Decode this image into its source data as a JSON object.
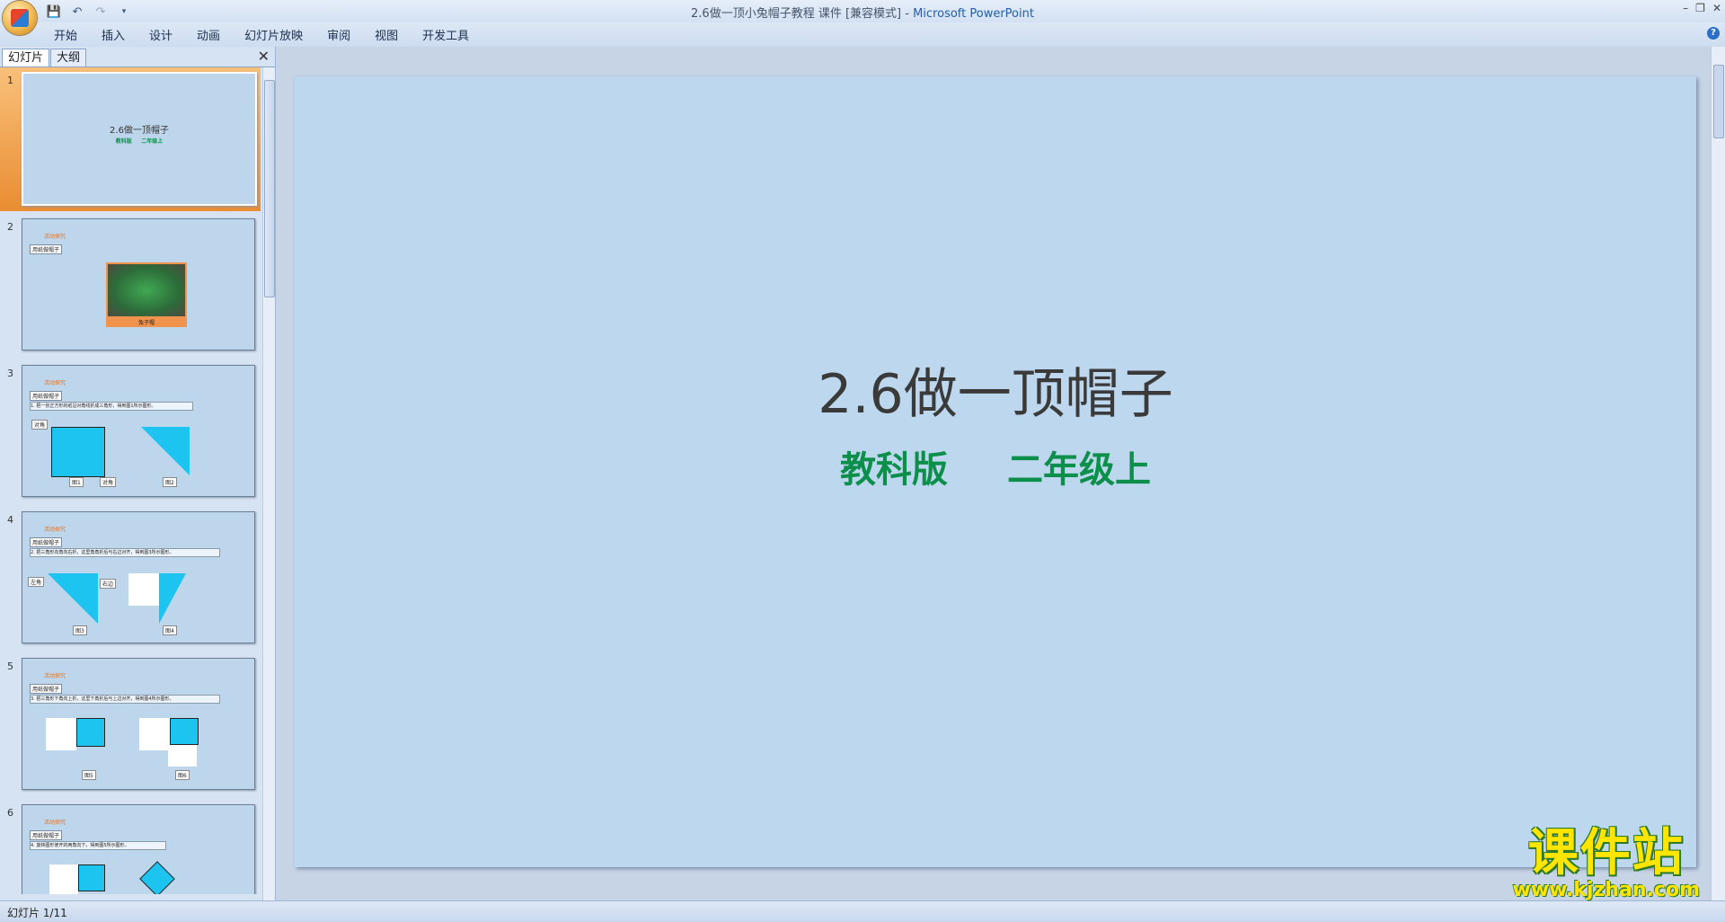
{
  "window": {
    "title": "2.6做一顶小兔帽子教程 课件 [兼容模式] - ",
    "app_name": "Microsoft PowerPoint",
    "controls": [
      "–",
      "❐",
      "✕"
    ]
  },
  "quick_access": {
    "save_icon": "save-icon",
    "undo_icon": "undo-icon",
    "redo_icon": "redo-icon",
    "customize_icon": "dropdown-arrow-icon"
  },
  "ribbon": {
    "tabs": [
      "开始",
      "插入",
      "设计",
      "动画",
      "幻灯片放映",
      "审阅",
      "视图",
      "开发工具"
    ],
    "help": "?"
  },
  "left_pane": {
    "tabs": [
      "幻灯片",
      "大纲"
    ],
    "close": "✕",
    "thumbnails": [
      {
        "num": "1",
        "title": "2.6做一顶帽子",
        "sub1": "教科版",
        "sub2": "二年级上"
      },
      {
        "num": "2",
        "heading": "活动探究",
        "label": "用纸做帽子",
        "caption": "兔子帽"
      },
      {
        "num": "3",
        "heading": "活动探究",
        "label": "用纸做帽子",
        "step": "1. 把一张正方形的纸沿对角线折成三角形，得到图1所示图形。",
        "c1": "对角",
        "c2": "图1",
        "c3": "对角",
        "c4": "图2"
      },
      {
        "num": "4",
        "heading": "活动探究",
        "label": "用纸做帽子",
        "step": "2. 把三角形向角向右折，这里角角折后与右边对齐，得到图3所示图形。",
        "c1": "左角",
        "c2": "右边",
        "c3": "图3",
        "c4": "图4"
      },
      {
        "num": "5",
        "heading": "活动探究",
        "label": "用纸做帽子",
        "step": "3. 把三角形下角向上折，这里下角折后与上边对齐，得到图4所示图形。",
        "c1": "图5",
        "c2": "图6"
      },
      {
        "num": "6",
        "heading": "活动探究",
        "label": "用纸做帽子",
        "step": "4. 旋转图形使开的两角向下，得到图5所示图形。"
      }
    ]
  },
  "slide": {
    "title": "2.6做一顶帽子",
    "subtitle_left": "教科版",
    "subtitle_right": "二年级上"
  },
  "status": {
    "text": "幻灯片 1/11"
  },
  "watermark": {
    "main": "课件站",
    "url": "www.kjzhan.com"
  },
  "colors": {
    "slide_bg": "#bdd7ee",
    "subtitle_green": "#0c8f4a",
    "selected_thumb": "#e98d32",
    "shape_cyan": "#1ec4f0"
  }
}
